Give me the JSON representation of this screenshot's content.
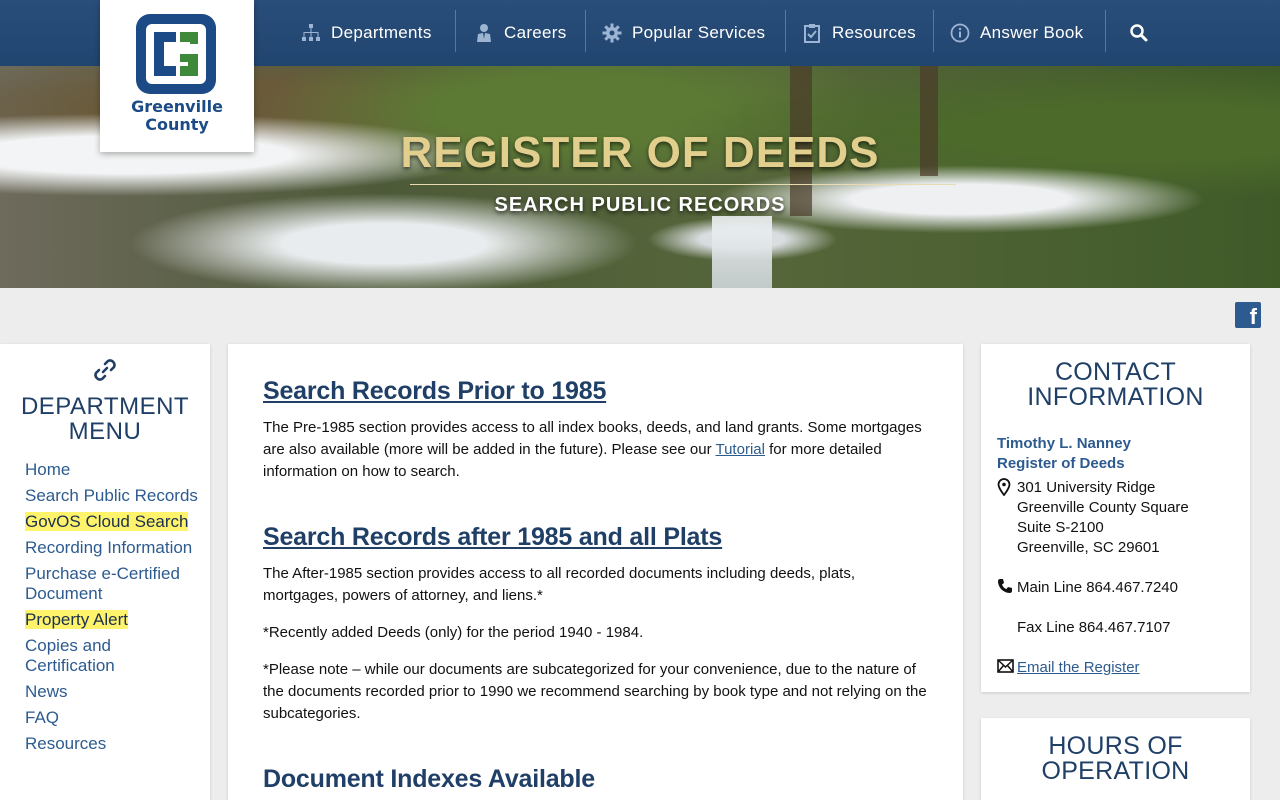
{
  "logo": {
    "line1": "Greenville",
    "line2": "County"
  },
  "nav": [
    {
      "label": "Departments",
      "icon": "org-chart-icon"
    },
    {
      "label": "Careers",
      "icon": "person-tie-icon"
    },
    {
      "label": "Popular Services",
      "icon": "gear-icon"
    },
    {
      "label": "Resources",
      "icon": "clipboard-check-icon"
    },
    {
      "label": "Answer Book",
      "icon": "info-circle-icon"
    }
  ],
  "hero": {
    "title": "REGISTER OF DEEDS",
    "subtitle": "SEARCH PUBLIC RECORDS"
  },
  "sidebar": {
    "title_line1": "DEPARTMENT",
    "title_line2": "MENU",
    "items": [
      {
        "label": "Home",
        "highlight": false
      },
      {
        "label": "Search Public Records",
        "highlight": false
      },
      {
        "label": "GovOS Cloud Search",
        "highlight": true
      },
      {
        "label": "Recording Information",
        "highlight": false
      },
      {
        "label": "Purchase e-Certified Document",
        "highlight": false
      },
      {
        "label": "Property Alert",
        "highlight": true
      },
      {
        "label": "Copies and Certification",
        "highlight": false
      },
      {
        "label": "News",
        "highlight": false
      },
      {
        "label": "FAQ",
        "highlight": false
      },
      {
        "label": "Resources",
        "highlight": false
      }
    ]
  },
  "main": {
    "s1_heading": "Search Records Prior to 1985",
    "s1_text_a": "The Pre-1985 section provides access to all index books, deeds, and land grants. Some mortgages are also available (more will be added in the future). Please see our ",
    "s1_link": "Tutorial",
    "s1_text_b": " for more detailed information on how to search.",
    "s2_heading": "Search Records after 1985 and all Plats",
    "s2_text": "The After-1985 section provides access to all recorded documents including deeds, plats, mortgages, powers of attorney, and liens.*",
    "s2_note1": "*Recently added Deeds (only) for the period 1940 - 1984.",
    "s2_note2": "*Please note – while our documents are subcategorized for your convenience, due to the nature of the documents recorded prior to 1990 we recommend searching by book type and not relying on the subcategories.",
    "s3_heading": "Document Indexes Available"
  },
  "contact": {
    "title_line1": "CONTACT",
    "title_line2": "INFORMATION",
    "name": "Timothy L. Nanney",
    "role": "Register of Deeds",
    "address": [
      "301 University Ridge",
      "Greenville County Square",
      "Suite S-2100",
      "Greenville, SC 29601"
    ],
    "main_line": "Main Line 864.467.7240",
    "fax_line": "Fax Line 864.467.7107",
    "email_link": "Email the Register"
  },
  "hours": {
    "title_line1": "HOURS OF",
    "title_line2": "OPERATION"
  },
  "colors": {
    "nav_bg": "#20456f",
    "accent": "#2d5b8f",
    "highlight": "#fff36b",
    "hero_title": "#e2cf8e"
  }
}
